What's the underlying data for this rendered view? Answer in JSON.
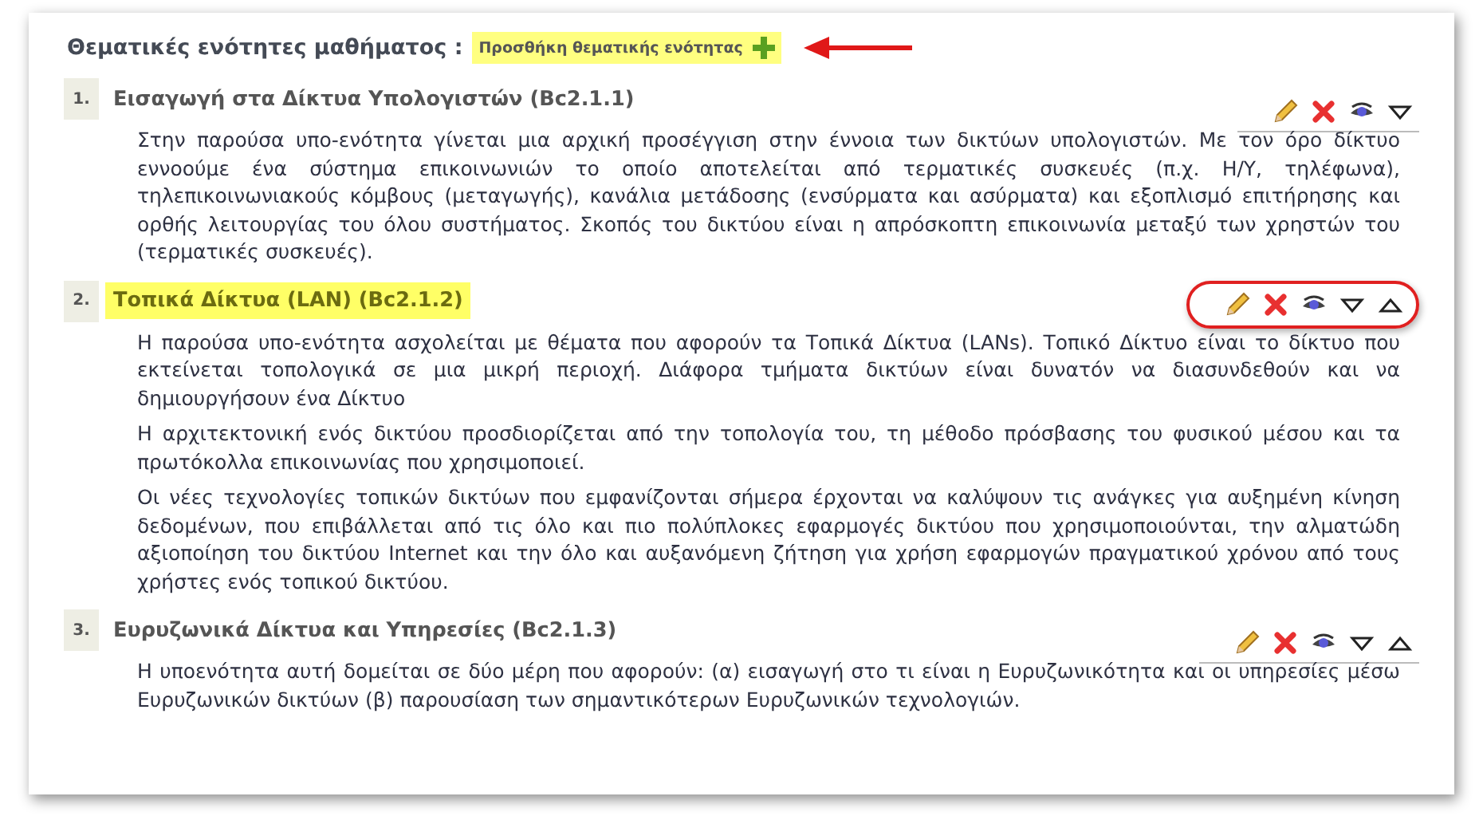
{
  "heading": {
    "title": "Θεματικές ενότητες μαθήματος :",
    "add_button": "Προσθήκη θεματικής ενότητας"
  },
  "sections": [
    {
      "number": "1.",
      "title": "Εισαγωγή στα Δίκτυα Υπολογιστών (Bc2.1.1)",
      "highlighted": false,
      "actions_circled": false,
      "actions": [
        {
          "kind": "edit"
        },
        {
          "kind": "delete"
        },
        {
          "kind": "visibility"
        },
        {
          "kind": "down"
        }
      ],
      "paragraphs": [
        "Στην παρούσα υπο-ενότητα γίνεται μια αρχική προσέγγιση στην έννοια των δικτύων υπολογιστών. Με τον όρο δίκτυο εννοούμε ένα σύστημα επικοινωνιών το οποίο αποτελείται από τερματικές συσκευές (π.χ. Η/Υ, τηλέφωνα), τηλεπικοινωνιακούς κόμβους (μεταγωγής), κανάλια μετάδοσης (ενσύρματα και ασύρματα) και εξοπλισμό επιτήρησης και ορθής λειτουργίας του όλου συστήματος. Σκοπός του δικτύου είναι η απρόσκοπτη επικοινωνία μεταξύ των χρηστών του (τερματικές συσκευές)."
      ]
    },
    {
      "number": "2.",
      "title": "Τοπικά Δίκτυα (LAN) (Bc2.1.2)",
      "highlighted": true,
      "actions_circled": true,
      "actions": [
        {
          "kind": "edit"
        },
        {
          "kind": "delete"
        },
        {
          "kind": "visibility"
        },
        {
          "kind": "down"
        },
        {
          "kind": "up"
        }
      ],
      "paragraphs": [
        "Η παρούσα υπο-ενότητα ασχολείται με θέματα που αφορούν τα Τοπικά Δίκτυα (LANs). Τοπικό Δίκτυο είναι το δίκτυο που εκτείνεται τοπολογικά σε μια μικρή περιοχή. Διάφορα τμήματα δικτύων είναι δυνατόν να διασυνδεθούν και να δημιουργήσουν ένα Δίκτυο",
        "Η αρχιτεκτονική ενός δικτύου προσδιορίζεται από την τοπολογία του, τη μέθοδο πρόσβασης του φυσικού μέσου και τα πρωτόκολλα επικοινωνίας που χρησιμοποιεί.",
        "Οι νέες τεχνολογίες τοπικών δικτύων που εμφανίζονται σήμερα έρχονται να καλύψουν τις ανάγκες για αυξημένη κίνηση δεδομένων, που επιβάλλεται από τις όλο και πιο πολύπλοκες εφαρμογές δικτύου που χρησιμοποιούνται, την αλματώδη αξιοποίηση του δικτύου Internet και την όλο και αυξανόμενη ζήτηση για χρήση εφαρμογών πραγματικού χρόνου από τους χρήστες ενός τοπικού δικτύου."
      ]
    },
    {
      "number": "3.",
      "title": "Ευρυζωνικά Δίκτυα και Υπηρεσίες (Bc2.1.3)",
      "highlighted": false,
      "actions_circled": false,
      "actions": [
        {
          "kind": "edit"
        },
        {
          "kind": "delete"
        },
        {
          "kind": "visibility"
        },
        {
          "kind": "down"
        },
        {
          "kind": "up"
        }
      ],
      "paragraphs": [
        "Η υποενότητα αυτή δομείται σε δύο μέρη που αφορούν: (α) εισαγωγή στο τι είναι η Ευρυζωνικότητα και οι υπηρεσίες μέσω Ευρυζωνικών δικτύων (β) παρουσίαση των σημαντικότερων Ευρυζωνικών τεχνολογιών."
      ]
    }
  ]
}
